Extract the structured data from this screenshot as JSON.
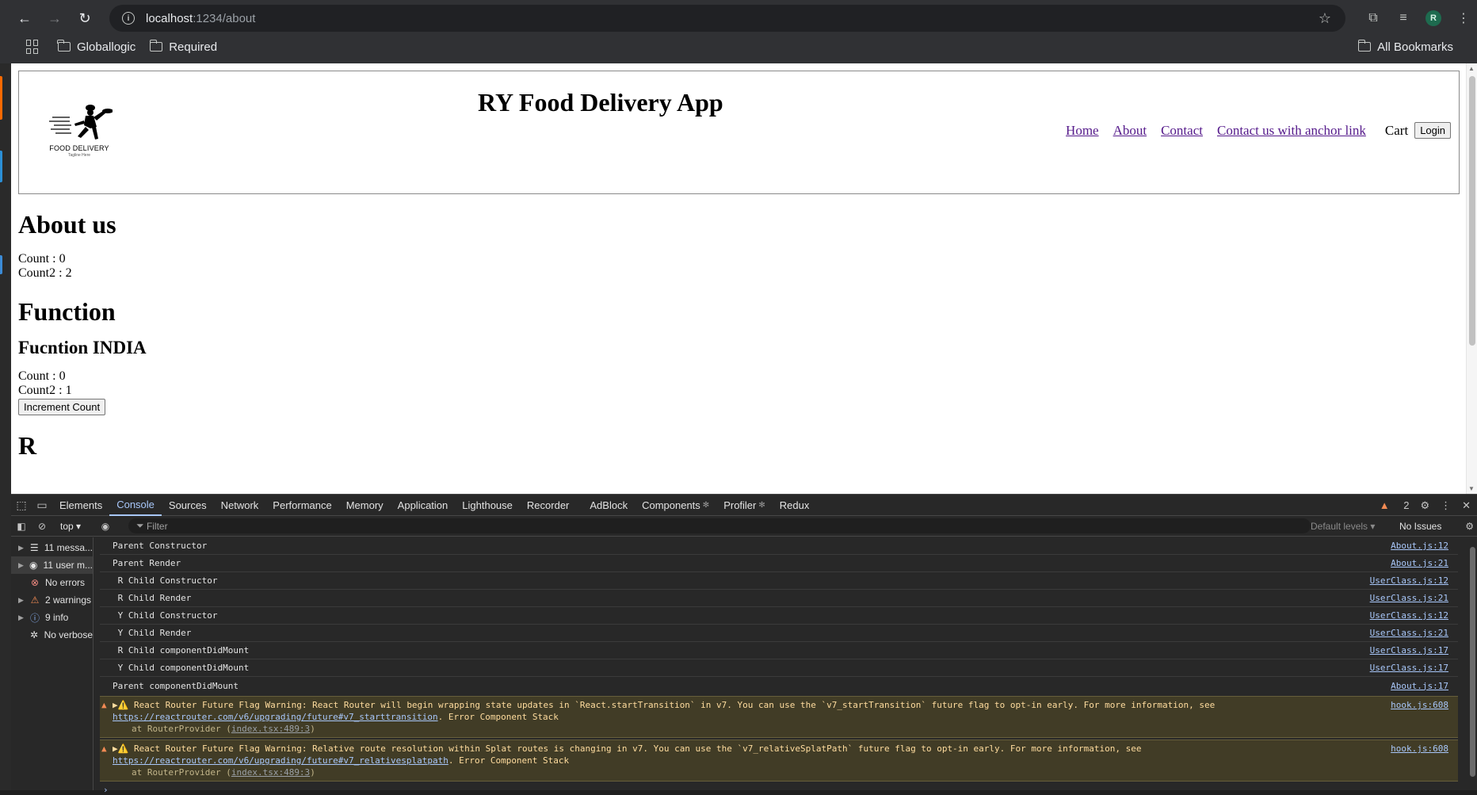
{
  "browser": {
    "url_host": "localhost",
    "url_path": ":1234/about",
    "bookmarks": [
      "Globallogic",
      "Required"
    ],
    "all_bookmarks": "All Bookmarks",
    "avatar_letter": "R"
  },
  "page": {
    "app_title": "RY Food Delivery App",
    "logo_text": "FOOD DELIVERY",
    "logo_tagline": "Tagline Here",
    "nav": [
      "Home",
      "About",
      "Contact",
      "Contact us with anchor link"
    ],
    "cart": "Cart",
    "login_label": "Login",
    "about_heading": "About us",
    "count_1": "Count : 0",
    "count2_1": "Count2 : 2",
    "function_heading": "Function",
    "function_sub": "Fucntion INDIA",
    "count_2": "Count : 0",
    "count2_2": "Count2 : 1",
    "increment_label": "Increment Count",
    "r_heading": "R"
  },
  "devtools": {
    "tabs": [
      "Elements",
      "Console",
      "Sources",
      "Network",
      "Performance",
      "Memory",
      "Application",
      "Lighthouse",
      "Recorder",
      "AdBlock",
      "Components",
      "Profiler",
      "Redux"
    ],
    "warning_badge": "2",
    "context": "top",
    "filter_placeholder": "Filter",
    "levels": "Default levels",
    "issues": "No Issues",
    "sidebar": [
      "11 messa...",
      "11 user m...",
      "No errors",
      "2 warnings",
      "9 info",
      "No verbose"
    ],
    "logs": [
      {
        "text": "Parent Constructor",
        "src": "About.js:12"
      },
      {
        "text": "Parent Render",
        "src": "About.js:21"
      },
      {
        "text": " R Child Constructor",
        "src": "UserClass.js:12"
      },
      {
        "text": " R Child Render",
        "src": "UserClass.js:21"
      },
      {
        "text": " Y Child Constructor",
        "src": "UserClass.js:12"
      },
      {
        "text": " Y Child Render",
        "src": "UserClass.js:21"
      },
      {
        "text": " R Child componentDidMount",
        "src": "UserClass.js:17"
      },
      {
        "text": " Y Child componentDidMount",
        "src": "UserClass.js:17"
      },
      {
        "text": "Parent componentDidMount",
        "src": "About.js:17"
      }
    ],
    "warnings": [
      {
        "line1": "▶⚠️ React Router Future Flag Warning: React Router will begin wrapping state updates in `React.startTransition` in v7. You can use the `v7_startTransition` future flag to opt-in early. For more information, see",
        "link": "https://reactrouter.com/v6/upgrading/future#v7_starttransition",
        "after_link": ". Error Component Stack",
        "stack": "at RouterProvider (",
        "stack_link": "index.tsx:489:3",
        "stack_end": ")",
        "src": "hook.js:608"
      },
      {
        "line1": "▶⚠️ React Router Future Flag Warning: Relative route resolution within Splat routes is changing in v7. You can use the `v7_relativeSplatPath` future flag to opt-in early. For more information, see",
        "link": "https://reactrouter.com/v6/upgrading/future#v7_relativesplatpath",
        "after_link": ". Error Component Stack",
        "stack": "at RouterProvider (",
        "stack_link": "index.tsx:489:3",
        "stack_end": ")",
        "src": "hook.js:608"
      }
    ]
  }
}
